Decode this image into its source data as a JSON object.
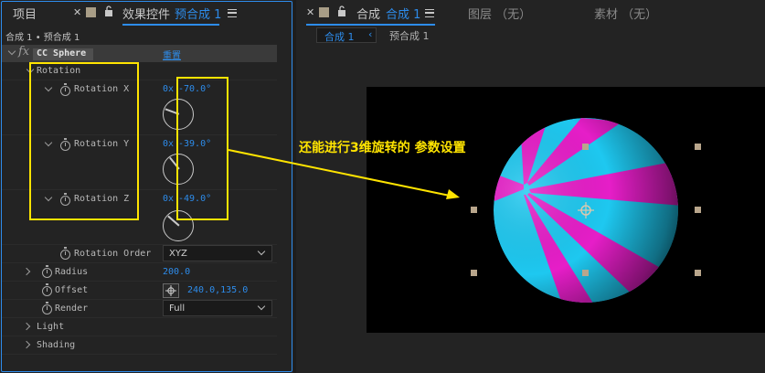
{
  "left_panel": {
    "tabs": {
      "project": "项目",
      "effect_controls": "效果控件",
      "effect_controls_layer": "预合成 1"
    },
    "breadcrumb": "合成 1 • 预合成 1",
    "effect": {
      "fx": "fx",
      "name": "CC Sphere",
      "reset": "重置"
    },
    "rotation_group": "Rotation",
    "properties": {
      "rotation_x": {
        "label": "Rotation X",
        "revolutions": "0x",
        "degrees": "-70.0°",
        "angle": -70
      },
      "rotation_y": {
        "label": "Rotation Y",
        "revolutions": "0x",
        "degrees": "-39.0°",
        "angle": -39
      },
      "rotation_z": {
        "label": "Rotation Z",
        "revolutions": "0x",
        "degrees": "-49.0°",
        "angle": -49
      },
      "rotation_order": {
        "label": "Rotation Order",
        "value": "XYZ"
      },
      "radius": {
        "label": "Radius",
        "value": "200.0"
      },
      "offset": {
        "label": "Offset",
        "value": "240.0,135.0"
      },
      "render": {
        "label": "Render",
        "value": "Full"
      },
      "light": {
        "label": "Light"
      },
      "shading": {
        "label": "Shading"
      }
    }
  },
  "right_panel": {
    "tabs": {
      "composition": "合成",
      "composition_name": "合成 1",
      "layer": "图层 （无）",
      "footage": "素材 （无）"
    },
    "breadcrumbs": {
      "active": "合成 1",
      "next": "预合成 1"
    }
  },
  "annotation": {
    "text": "还能进行3维旋转的 参数设置",
    "color": "#ffe400"
  },
  "colors": {
    "accent": "#2d8ceb",
    "sphere_cyan": "#1ec8f0",
    "sphere_magenta": "#e61ec8",
    "highlight_box": "#ffe400"
  }
}
